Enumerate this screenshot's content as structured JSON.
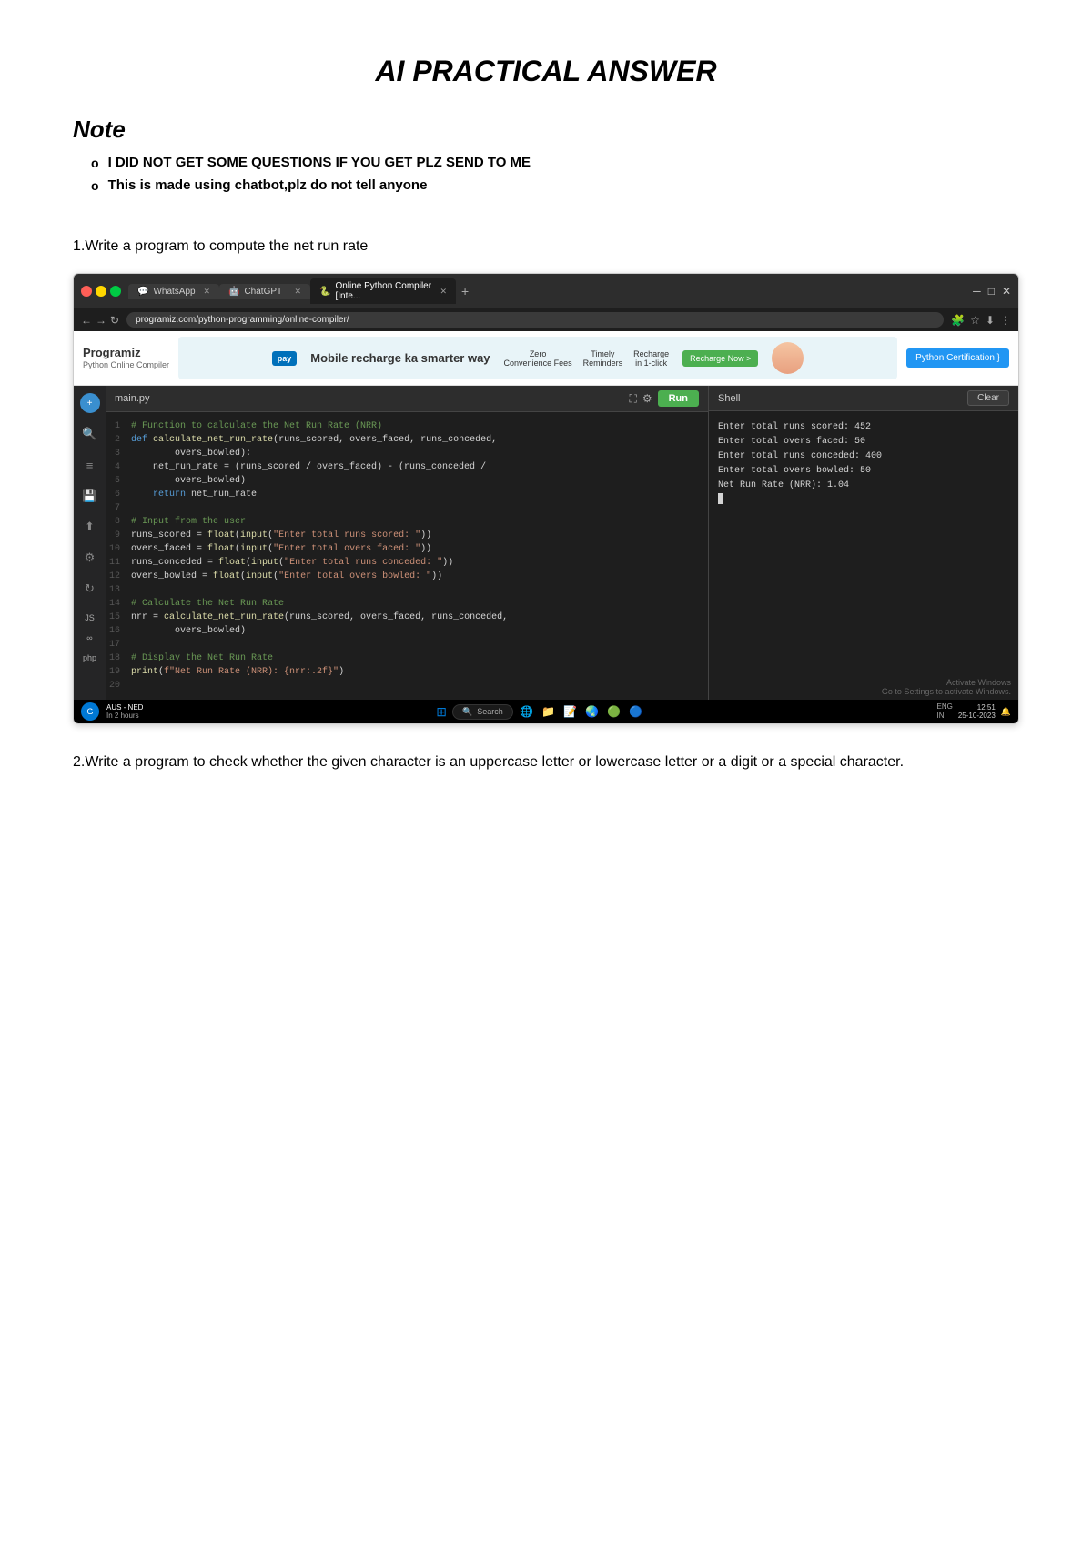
{
  "page": {
    "title": "AI PRACTICAL ANSWER",
    "note": {
      "label": "Note",
      "items": [
        "I DID NOT GET SOME QUESTIONS IF YOU GET PLZ SEND TO ME",
        "This is made using chatbot,plz do not tell anyone"
      ]
    },
    "question1": "1.Write a program to compute the net run rate",
    "question2": "2.Write a program to check whether the given character is an uppercase letter or lowercase letter or a digit or a special character."
  },
  "browser": {
    "tabs": [
      {
        "label": "WhatsApp",
        "icon": "💬",
        "active": false
      },
      {
        "label": "ChatGPT",
        "icon": "🤖",
        "active": false
      },
      {
        "label": "Online Python Compiler [Inte...",
        "icon": "🐍",
        "active": true
      }
    ],
    "address": "programiz.com/python-programming/online-compiler/",
    "programiz_logo": "Programiz",
    "programiz_sub": "Python Online Compiler",
    "ad_text": "Mobile recharge ka smarter way",
    "ad_features": [
      "Zero\nConvenience Fees",
      "Timely\nReminders",
      "Recharge\nin 1-click"
    ],
    "ad_recharge_btn": "Recharge Now >",
    "cert_btn": "Python Certification }",
    "file_name": "main.py",
    "run_btn": "Run",
    "clear_btn": "Clear",
    "shell_title": "Shell",
    "shell_output": [
      "Enter total runs scored: 452",
      "Enter total overs faced: 50",
      "Enter total runs conceded: 400",
      "Enter total overs bowled: 50",
      "Net Run Rate (NRR): 1.04"
    ],
    "activate_text": "Activate Windows",
    "activate_sub": "Go to Settings to activate Windows.",
    "code_lines": [
      "# Function to calculate the Net Run Rate (NRR)",
      "def calculate_net_run_rate(runs_scored, overs_faced, runs_conceded,",
      "        overs_bowled):",
      "    net_run_rate = (runs_scored / overs_faced) - (runs_conceded /",
      "        overs_bowled)",
      "    return net_run_rate",
      "",
      "# Input from the user",
      "runs_scored = float(input(\"Enter total runs scored: \"))",
      "overs_faced = float(input(\"Enter total overs faced: \"))",
      "runs_conceded = float(input(\"Enter total runs conceded: \"))",
      "overs_bowled = float(input(\"Enter total overs bowled: \"))",
      "",
      "# Calculate the Net Run Rate",
      "nrr = calculate_net_run_rate(runs_scored, overs_faced, runs_conceded,",
      "        overs_bowled)",
      "",
      "# Display the Net Run Rate",
      "print(f\"Net Run Rate (NRR): {nrr:.2f}\")",
      ""
    ],
    "taskbar": {
      "time": "12:51",
      "date": "25-10-2023",
      "lang": "ENG\nIN",
      "app_label": "AUS - NED",
      "app_sub": "In 2 hours",
      "search_placeholder": "Search"
    }
  }
}
